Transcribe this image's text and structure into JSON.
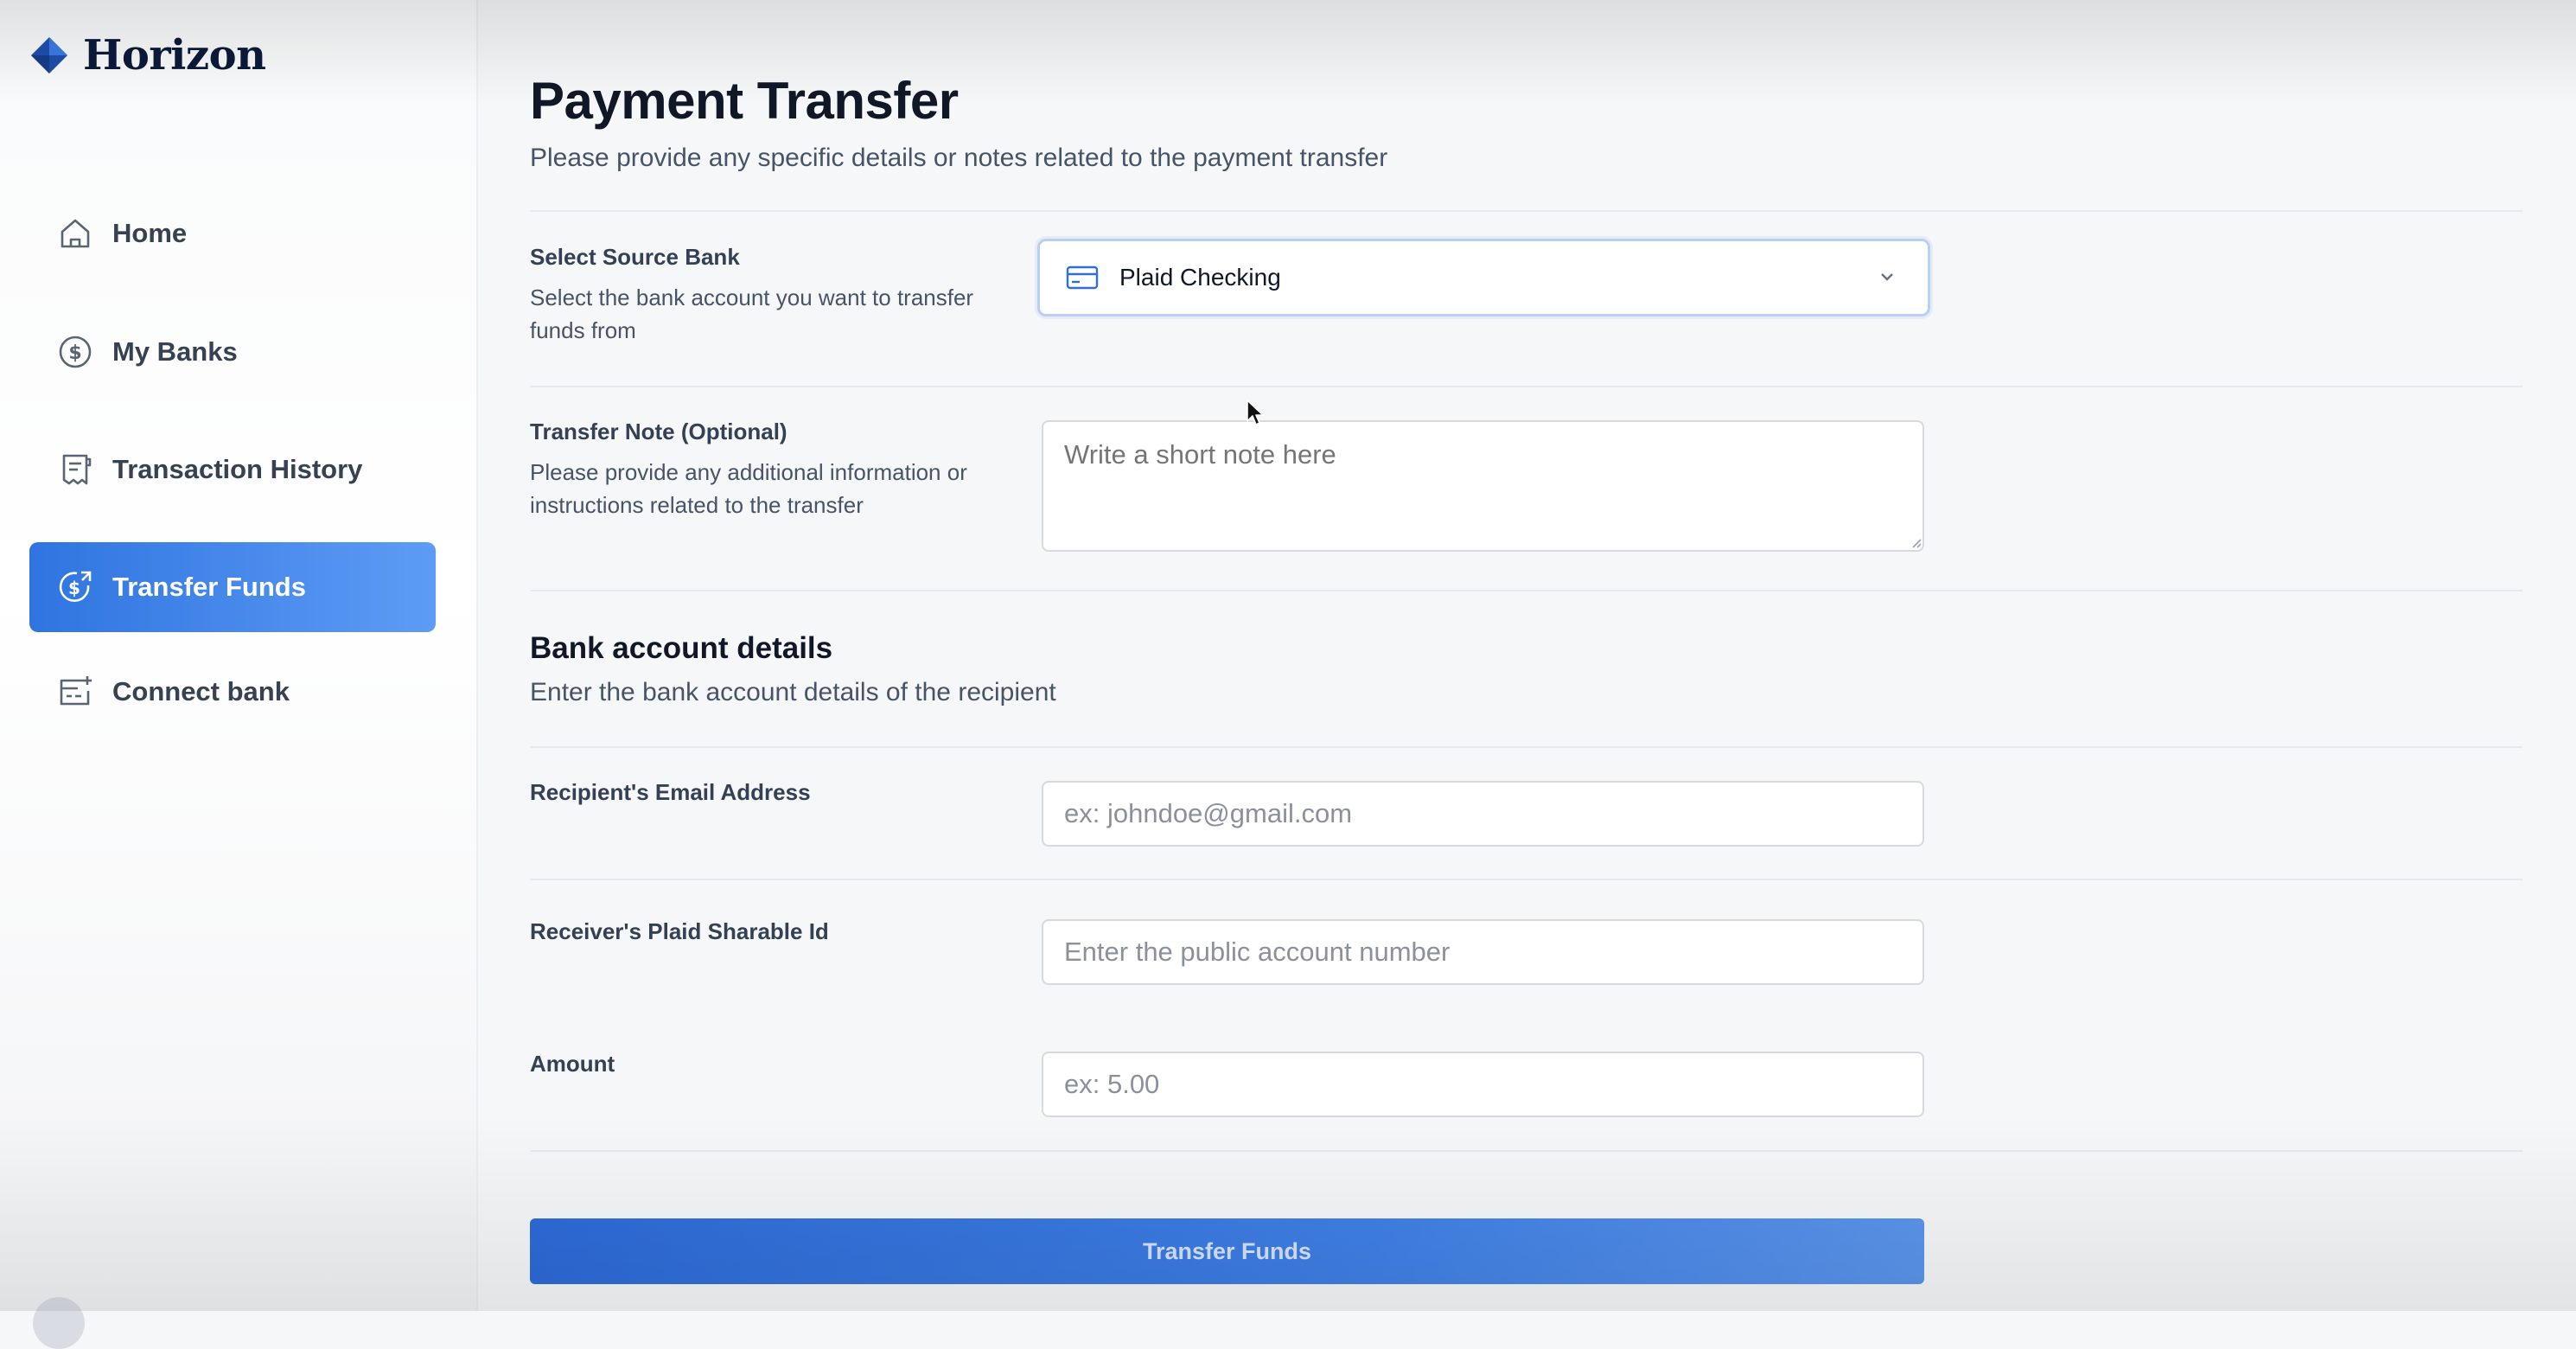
{
  "app": {
    "brand": "Horizon",
    "accent_color": "#2f74e0"
  },
  "sidebar": {
    "items": [
      {
        "label": "Home",
        "icon": "home-icon",
        "active": false
      },
      {
        "label": "My Banks",
        "icon": "dollar-circle-icon",
        "active": false
      },
      {
        "label": "Transaction History",
        "icon": "receipt-icon",
        "active": false
      },
      {
        "label": "Transfer Funds",
        "icon": "transfer-dollar-icon",
        "active": true
      },
      {
        "label": "Connect bank",
        "icon": "connect-bank-icon",
        "active": false
      }
    ]
  },
  "header": {
    "title": "Payment Transfer",
    "subtitle": "Please provide any specific details or notes related to the payment transfer"
  },
  "form": {
    "source_bank": {
      "label": "Select Source Bank",
      "help": "Select the bank account you want to transfer funds from",
      "selected_value": "Plaid Checking",
      "icon": "credit-card-icon"
    },
    "note": {
      "label": "Transfer Note (Optional)",
      "help": "Please provide any additional information or instructions related to the transfer",
      "placeholder": "Write a short note here"
    },
    "bank_details": {
      "title": "Bank account details",
      "subtitle": "Enter the bank account details of the recipient"
    },
    "email": {
      "label": "Recipient's Email Address",
      "placeholder": "ex: johndoe@gmail.com"
    },
    "sharable_id": {
      "label": "Receiver's Plaid Sharable Id",
      "placeholder": "Enter the public account number"
    },
    "amount": {
      "label": "Amount",
      "placeholder": "ex: 5.00"
    },
    "submit_label": "Transfer Funds"
  }
}
